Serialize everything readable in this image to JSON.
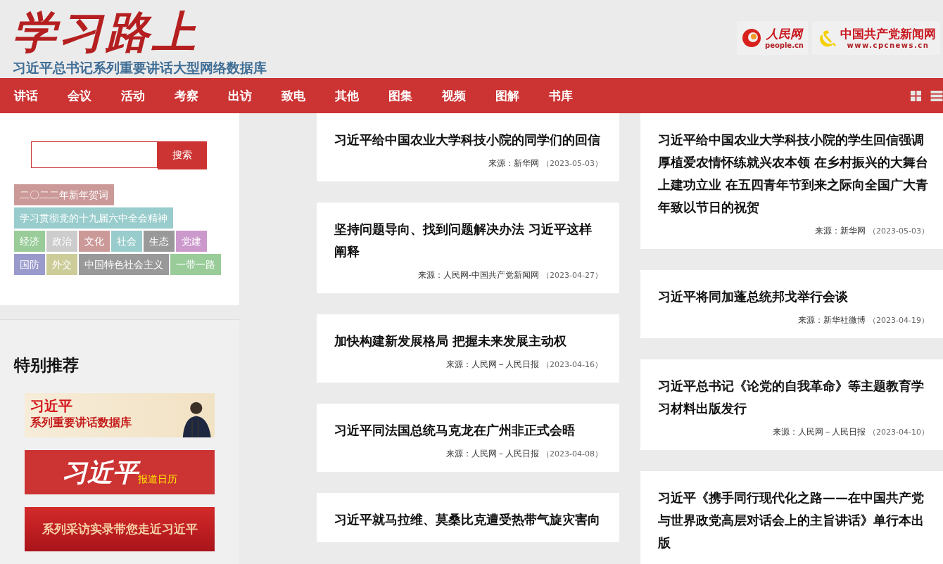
{
  "header": {
    "title": "学习路上",
    "subtitle": "习近平总书记系列重要讲话大型网络数据库",
    "partners": [
      {
        "name": "人民网",
        "url": "people.cn",
        "kind": "people"
      },
      {
        "name": "中国共产党新闻网",
        "url": "www.cpcnews.cn",
        "kind": "cpc"
      }
    ]
  },
  "nav": {
    "items": [
      "讲话",
      "会议",
      "活动",
      "考察",
      "出访",
      "致电",
      "其他",
      "图集",
      "视频",
      "图解",
      "书库"
    ]
  },
  "search": {
    "button": "搜索"
  },
  "tags": [
    [
      {
        "label": "二〇二二年新年贺词",
        "color": "#cc9999"
      }
    ],
    [
      {
        "label": "学习贯彻党的十九届六中全会精神",
        "color": "#99cccc"
      }
    ],
    [
      {
        "label": "经济",
        "color": "#99cc99"
      },
      {
        "label": "政治",
        "color": "#cccccc"
      },
      {
        "label": "文化",
        "color": "#cc9999"
      },
      {
        "label": "社会",
        "color": "#99cccc"
      },
      {
        "label": "生态",
        "color": "#999999"
      },
      {
        "label": "党建",
        "color": "#cc99cc"
      }
    ],
    [
      {
        "label": "国防",
        "color": "#9999cc"
      },
      {
        "label": "外交",
        "color": "#cccc99"
      },
      {
        "label": "中国特色社会主义",
        "color": "#999999"
      },
      {
        "label": "一带一路",
        "color": "#99cc99"
      }
    ]
  ],
  "recommend": {
    "heading": "特别推荐",
    "banners": [
      {
        "kind": "database",
        "title": "习近平",
        "subtitle": "系列重要讲话数据库"
      },
      {
        "kind": "calendar",
        "title": "习近平",
        "subtitle": "报道日历"
      },
      {
        "kind": "interview",
        "title": "系列采访实录带您走近习近平"
      }
    ]
  },
  "columns": [
    [
      {
        "title": "习近平给中国农业大学科技小院的同学们的回信",
        "source": "来源：新华网",
        "date": "（2023-05-03）"
      },
      {
        "title": "坚持问题导向、找到问题解决办法 习近平这样阐释",
        "source": "来源：人民网-中国共产党新闻网",
        "date": "（2023-04-27）"
      },
      {
        "title": "加快构建新发展格局 把握未来发展主动权",
        "source": "来源：人民网－人民日报",
        "date": "（2023-04-16）"
      },
      {
        "title": "习近平同法国总统马克龙在广州非正式会晤",
        "source": "来源：人民网－人民日报",
        "date": "（2023-04-08）"
      },
      {
        "title": "习近平就马拉维、莫桑比克遭受热带气旋灾害向"
      }
    ],
    [
      {
        "title": "习近平给中国农业大学科技小院的学生回信强调厚植爱农情怀练就兴农本领 在乡村振兴的大舞台上建功立业 在五四青年节到来之际向全国广大青年致以节日的祝贺",
        "source": "来源：新华网",
        "date": "（2023-05-03）"
      },
      {
        "title": "习近平将同加蓬总统邦戈举行会谈",
        "source": "来源：新华社微博",
        "date": "（2023-04-19）"
      },
      {
        "title": "习近平总书记《论党的自我革命》等主题教育学习材料出版发行",
        "source": "来源：人民网－人民日报",
        "date": "（2023-04-10）"
      },
      {
        "title": "习近平《携手同行现代化之路——在中国共产党与世界政党高层对话会上的主旨讲话》单行本出版"
      }
    ]
  ]
}
